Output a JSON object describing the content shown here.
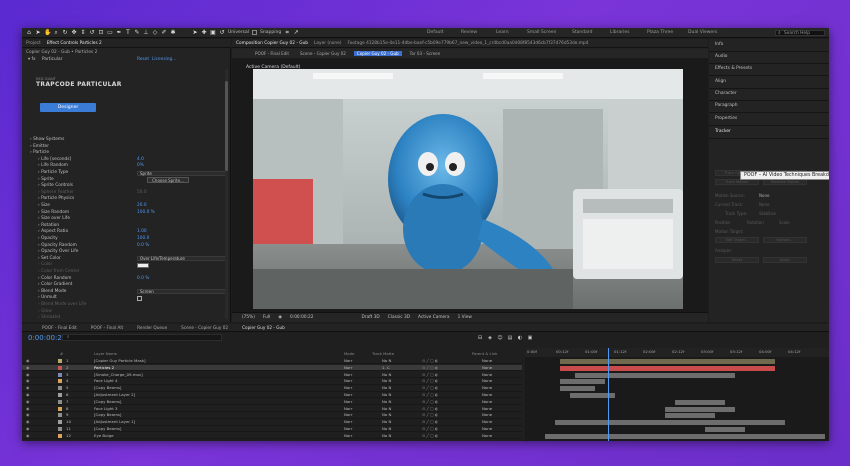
{
  "toolbar": {
    "universal_label": "Universal",
    "snapping_label": "Snapping",
    "workspaces": [
      "Default",
      "Review",
      "Learn",
      "Small Screen",
      "Standard",
      "Libraries",
      "Plaza Three",
      "Dual Viewers"
    ],
    "search_placeholder": "Search Help"
  },
  "left_panel": {
    "tabs": [
      "Project",
      "Effect Controls  Particles 2"
    ],
    "path": "Copier Guy 02 - Gub • Particles 2",
    "effect": {
      "name": "Particular",
      "reset": "Reset",
      "licensing": "Licensing..."
    },
    "logo": {
      "line1": "RED GIANT",
      "line2": "TRAPCODE PARTICULAR"
    },
    "designer_button": "Designer",
    "rows": [
      {
        "label": "Show Systems",
        "value": "",
        "dim": false,
        "indent": 0
      },
      {
        "label": "Emitter",
        "value": "",
        "dim": false,
        "indent": 0
      },
      {
        "label": "Particle",
        "value": "",
        "dim": false,
        "indent": 0
      },
      {
        "label": "Life [seconds]",
        "value": "4.0",
        "dim": false,
        "indent": 1
      },
      {
        "label": "Life Random",
        "value": "0%",
        "dim": false,
        "indent": 1
      },
      {
        "label": "Particle Type",
        "value": "Sprite",
        "dim": false,
        "indent": 1,
        "dropdown": true
      },
      {
        "label": "Sprite",
        "value": "Choose Sprite...",
        "dim": false,
        "indent": 1,
        "button": true
      },
      {
        "label": "Sprite Controls",
        "value": "",
        "dim": false,
        "indent": 1
      },
      {
        "label": "Sphere Feather",
        "value": "50.0",
        "dim": true,
        "indent": 1
      },
      {
        "label": "Particle Physics",
        "value": "",
        "dim": false,
        "indent": 1
      },
      {
        "label": "Size",
        "value": "20.0",
        "dim": false,
        "indent": 1
      },
      {
        "label": "Size Random",
        "value": "100.0 %",
        "dim": false,
        "indent": 1
      },
      {
        "label": "Size over Life",
        "value": "",
        "dim": false,
        "indent": 1
      },
      {
        "label": "Rotation",
        "value": "",
        "dim": false,
        "indent": 1
      },
      {
        "label": "Aspect Ratio",
        "value": "1.00",
        "dim": false,
        "indent": 1
      },
      {
        "label": "Opacity",
        "value": "100.0",
        "dim": false,
        "indent": 1
      },
      {
        "label": "Opacity Random",
        "value": "0.0 %",
        "dim": false,
        "indent": 1
      },
      {
        "label": "Opacity Over Life",
        "value": "",
        "dim": false,
        "indent": 1
      },
      {
        "label": "Set Color",
        "value": "Over Life/Temperature",
        "dim": false,
        "indent": 1,
        "dropdown": true
      },
      {
        "label": "Color",
        "value": "",
        "dim": true,
        "indent": 1,
        "swatch": true
      },
      {
        "label": "Color from Center",
        "value": "",
        "dim": true,
        "indent": 1
      },
      {
        "label": "Color Random",
        "value": "0.0 %",
        "dim": false,
        "indent": 1
      },
      {
        "label": "Color Gradient",
        "value": "",
        "dim": false,
        "indent": 1
      },
      {
        "label": "Blend Mode",
        "value": "Screen",
        "dim": false,
        "indent": 1,
        "dropdown": true
      },
      {
        "label": "Unmult",
        "value": "",
        "dim": false,
        "indent": 1,
        "checkbox": true
      },
      {
        "label": "Blend Mode over Life",
        "value": "",
        "dim": true,
        "indent": 1
      },
      {
        "label": "Glow",
        "value": "",
        "dim": true,
        "indent": 1
      },
      {
        "label": "Streaklet",
        "value": "",
        "dim": true,
        "indent": 1
      }
    ]
  },
  "composition": {
    "tabs": [
      "Composition  Copier Guy 02 - Gub",
      "Layer  (none)",
      "Footage  4128b15e-4e11-4dbe-baef-c5b09e779b67_new_video_1_cr4bcd0aa0d08f8543d6cb7f37d76d53de.mp4"
    ],
    "sub_tabs": [
      "POOF - Final Edit",
      "Scene - Copier Guy 02",
      "Copier Guy 02 - Gub",
      "Tor 03 - Screen"
    ],
    "active_sub_tab": 2,
    "camera_label": "Active Camera (Default)",
    "footer": {
      "zoom": "(75%)",
      "resolution": "Full",
      "timecode": "0:00:00:22",
      "renderer": "Draft 3D",
      "renderer_mode": "Classic 3D",
      "camera": "Active Camera",
      "views": "1 View"
    }
  },
  "right_panel": {
    "items": [
      "Info",
      "Audio",
      "Effects & Presets",
      "Align",
      "Character",
      "Paragraph",
      "Properties",
      "Tracker"
    ],
    "tracker": {
      "buttons": [
        "Track Camera",
        "Warp Stabilizer",
        "Track Motion",
        "Stabilize Motion"
      ],
      "motion_source_label": "Motion Source:",
      "motion_source_value": "None",
      "current_track_label": "Current Track:",
      "current_track_value": "None",
      "track_type_label": "Track Type:",
      "track_type_value": "Stabilize",
      "position_label": "Position",
      "rotation_label": "Rotation",
      "scale_label": "Scale",
      "motion_target_label": "Motion Target:",
      "edit_target": "Edit Target...",
      "options": "Options...",
      "analyze_label": "Analyze:",
      "reset": "Reset",
      "apply": "Apply"
    },
    "tooltip": "POOF – AI Video Techniques Breakdown"
  },
  "timeline": {
    "tabs": [
      "POOF - Final Edit",
      "POOF - Final Alt",
      "Render Queue",
      "Scene - Copier Guy 02",
      "Copier Guy 02 - Gub"
    ],
    "active_tab": 4,
    "timecode": "0:00:00:22",
    "search_placeholder": "",
    "headers": {
      "num": "#",
      "name": "Layer Name",
      "mode": "Mode",
      "trkmat": "Track Matte",
      "parent": "Parent & Link"
    },
    "layers": [
      {
        "num": "1",
        "name": "[Copier Guy Particle Mask]",
        "mode": "Norr",
        "matte": "No N",
        "parent": "None",
        "color": "#b5a96b",
        "selected": false
      },
      {
        "num": "2",
        "name": "Particles 2",
        "mode": "Norr",
        "matte": "1. C",
        "parent": "None",
        "color": "#c25757",
        "selected": true
      },
      {
        "num": "3",
        "name": "[Smoke_Charge_09.mov]",
        "mode": "Norr",
        "matte": "No N",
        "parent": "None",
        "color": "#7c89b8",
        "selected": false
      },
      {
        "num": "4",
        "name": "Face Light 4",
        "mode": "Norr",
        "matte": "No N",
        "parent": "None",
        "color": "#d9a35e",
        "selected": false
      },
      {
        "num": "5",
        "name": "[Copy Beams]",
        "mode": "Norr",
        "matte": "No N",
        "parent": "None",
        "color": "#8e8e8e",
        "selected": false
      },
      {
        "num": "6",
        "name": "[Adjustment Layer 2]",
        "mode": "Norr",
        "matte": "No N",
        "parent": "None",
        "color": "#a0a0a0",
        "selected": false
      },
      {
        "num": "7",
        "name": "[Copy Beams]",
        "mode": "Norr",
        "matte": "No N",
        "parent": "None",
        "color": "#8e8e8e",
        "selected": false
      },
      {
        "num": "8",
        "name": "Face Light 3",
        "mode": "Norr",
        "matte": "No N",
        "parent": "None",
        "color": "#d9a35e",
        "selected": false
      },
      {
        "num": "9",
        "name": "[Copy Beams]",
        "mode": "Norr",
        "matte": "No N",
        "parent": "None",
        "color": "#8e8e8e",
        "selected": false
      },
      {
        "num": "10",
        "name": "[Adjustment Layer 1]",
        "mode": "Norr",
        "matte": "No N",
        "parent": "None",
        "color": "#a0a0a0",
        "selected": false
      },
      {
        "num": "11",
        "name": "[Copy Beams]",
        "mode": "Norr",
        "matte": "No N",
        "parent": "None",
        "color": "#8e8e8e",
        "selected": false
      },
      {
        "num": "12",
        "name": "Eye Bulge",
        "mode": "Norr",
        "matte": "No N",
        "parent": "None",
        "color": "#d9a35e",
        "selected": false
      }
    ],
    "ruler_ticks": [
      "0:00f",
      "00:12f",
      "01:00f",
      "01:12f",
      "02:00f",
      "02:12f",
      "03:00f",
      "03:12f",
      "04:00f",
      "04:12f"
    ],
    "playhead_time": "0:00:00:22"
  }
}
